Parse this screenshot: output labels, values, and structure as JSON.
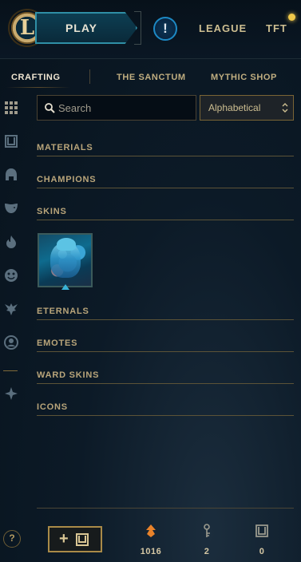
{
  "header": {
    "play_label": "PLAY",
    "alert_glyph": "!",
    "nav": [
      "LEAGUE",
      "TFT"
    ],
    "logo_letter": "L"
  },
  "tabs": [
    {
      "label": "CRAFTING",
      "active": true
    },
    {
      "label": "THE SANCTUM",
      "active": false
    },
    {
      "label": "MYTHIC SHOP",
      "active": false
    }
  ],
  "sidebar": {
    "icons": [
      "grid-icon",
      "chest-icon",
      "champion-helmet-icon",
      "mask-icon",
      "ward-flame-icon",
      "emote-face-icon",
      "summoner-icon",
      "profile-icon",
      "tft-icon"
    ]
  },
  "search": {
    "placeholder": "Search"
  },
  "sort": {
    "selected": "Alphabetical"
  },
  "categories": [
    {
      "label": "MATERIALS"
    },
    {
      "label": "CHAMPIONS"
    },
    {
      "label": "SKINS"
    },
    {
      "label": "ETERNALS"
    },
    {
      "label": "EMOTES"
    },
    {
      "label": "WARD SKINS"
    },
    {
      "label": "ICONS"
    }
  ],
  "footer": {
    "help_glyph": "?",
    "add_plus": "+",
    "currencies": [
      {
        "icon": "orange-essence-icon",
        "value": "1016"
      },
      {
        "icon": "key-icon",
        "value": "2"
      },
      {
        "icon": "chest-icon",
        "value": "0"
      }
    ]
  },
  "colors": {
    "gold": "#cdbe91",
    "accent_blue": "#2f8fa6",
    "orange_essence": "#e8822a",
    "background": "#0a1621"
  }
}
